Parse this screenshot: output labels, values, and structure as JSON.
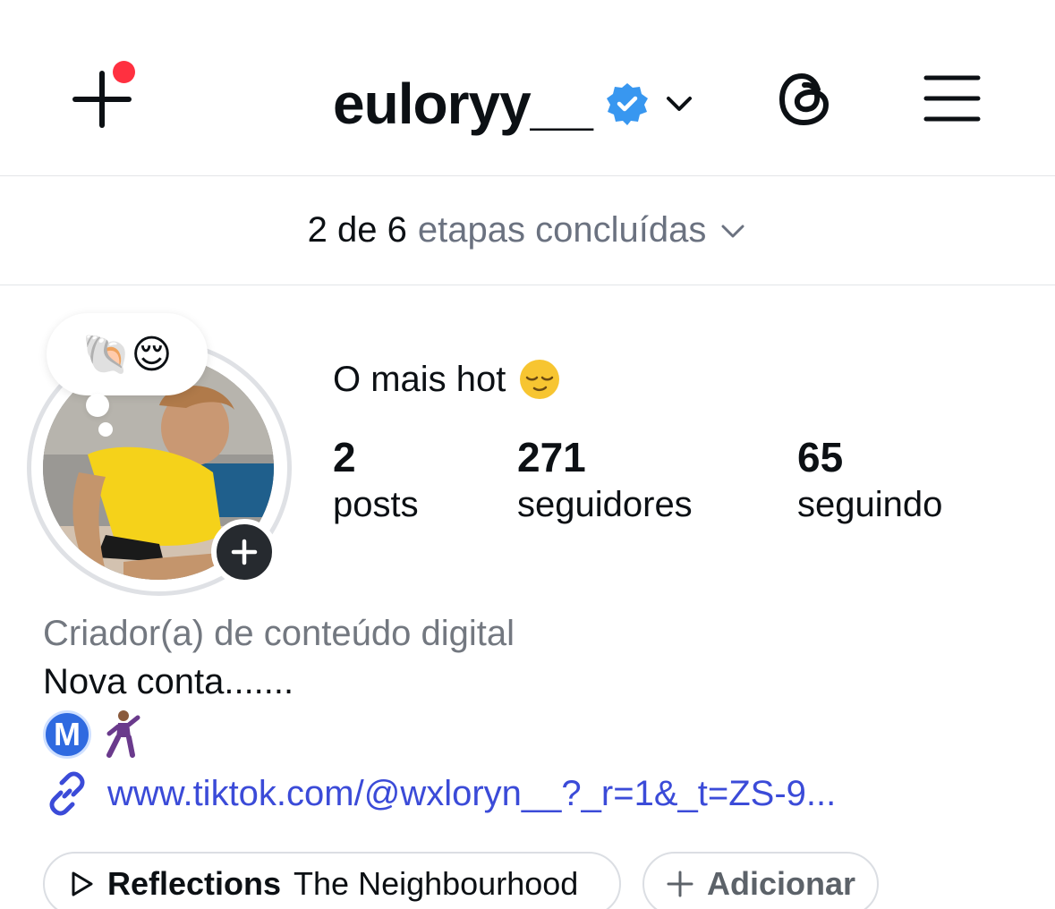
{
  "header": {
    "username": "euloryy__",
    "verified": true,
    "has_notification": true,
    "accent_color": "#ff3040",
    "verified_color": "#3897f0"
  },
  "steps_banner": {
    "count": "2 de 6",
    "text": "etapas concluídas"
  },
  "note": {
    "emojis": "🐚😌"
  },
  "profile": {
    "display_name": "O mais hot",
    "display_emoji": "relieved-face"
  },
  "stats": [
    {
      "value": "2",
      "label": "posts"
    },
    {
      "value": "271",
      "label": "seguidores"
    },
    {
      "value": "65",
      "label": "seguindo"
    }
  ],
  "bio": {
    "category": "Criador(a) de conteúdo digital",
    "text": "Nova conta.......",
    "badge_letter": "M",
    "link": "www.tiktok.com/@wxloryn__?_r=1&_t=ZS-9..."
  },
  "music_chip": {
    "title": "Reflections",
    "artist": "The Neighbourhood"
  },
  "add_chip": {
    "label": "Adicionar"
  },
  "link_color": "#3b4bd8"
}
